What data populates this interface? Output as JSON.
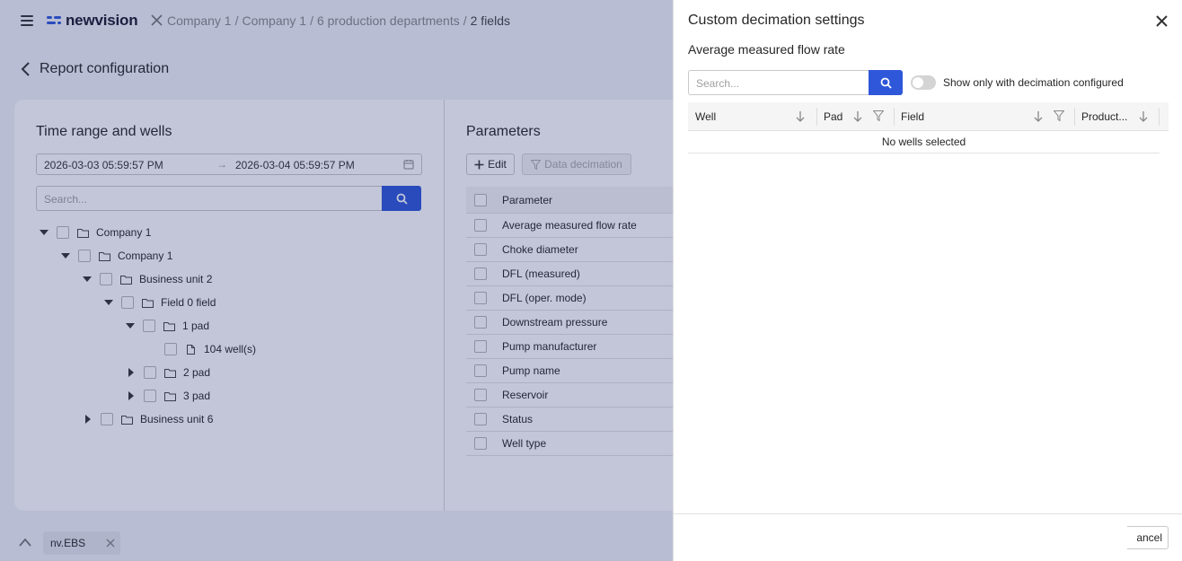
{
  "header": {
    "logo_text": "newvision",
    "breadcrumb": [
      "Company 1",
      "Company 1",
      "6 production departments",
      "2 fields"
    ],
    "separator": "/"
  },
  "page": {
    "back_title": "Report configuration"
  },
  "left_panel": {
    "title": "Time range and wells",
    "date_from": "2026-03-03 05:59:57 PM",
    "date_to": "2026-03-04 05:59:57 PM",
    "range_arrow": "→",
    "search_placeholder": "Search...",
    "tree": [
      {
        "label": "Company 1",
        "state": "expanded"
      },
      {
        "label": "Company 1",
        "state": "expanded"
      },
      {
        "label": "Business unit 2",
        "state": "expanded"
      },
      {
        "label": "Field 0 field",
        "state": "expanded"
      },
      {
        "label": "1 pad",
        "state": "expanded"
      },
      {
        "label": "104 well(s)",
        "state": "leaf"
      },
      {
        "label": "2 pad",
        "state": "collapsed"
      },
      {
        "label": "3 pad",
        "state": "collapsed"
      },
      {
        "label": "Business unit 6",
        "state": "collapsed"
      }
    ]
  },
  "params_panel": {
    "title": "Parameters",
    "edit_label": "Edit",
    "decimation_label": "Data decimation",
    "column_header": "Parameter",
    "rows": [
      "Average measured flow rate",
      "Choke diameter",
      "DFL (measured)",
      "DFL (oper. mode)",
      "Downstream pressure",
      "Pump manufacturer",
      "Pump name",
      "Reservoir",
      "Status",
      "Well type"
    ]
  },
  "bottom_bar": {
    "chip_label": "nv.EBS"
  },
  "drawer": {
    "title": "Custom decimation settings",
    "subtitle": "Average measured flow rate",
    "search_placeholder": "Search...",
    "toggle_label": "Show only with decimation configured",
    "toggle_on": false,
    "columns": [
      "Well",
      "Pad",
      "Field",
      "Product..."
    ],
    "empty_text": "No wells selected",
    "cancel_label": "Cancel",
    "cancel_visible_text": "ancel"
  },
  "colors": {
    "accent": "#2f57d9",
    "overlay": "rgba(30,45,110,0.27)"
  }
}
